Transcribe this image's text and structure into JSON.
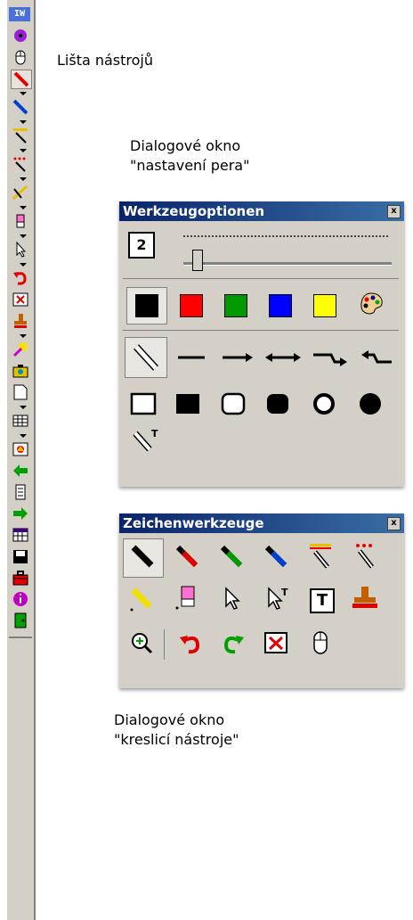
{
  "toolbar": {
    "logo": "IW",
    "label": "Lišta nástrojů",
    "icons": [
      "target-icon",
      "mouse-icon",
      "red-pen-icon",
      "blue-pen-icon",
      "highlighter-icon",
      "dots-pen-icon",
      "line-tool-icon",
      "eraser-icon",
      "pointer-icon",
      "undo-icon",
      "clear-icon",
      "stamp-icon",
      "torch-icon",
      "camera-icon",
      "page-icon",
      "grid-icon",
      "screen-icon",
      "back-arrow-icon",
      "page-list-icon",
      "forward-arrow-icon",
      "calendar-icon",
      "save-icon",
      "toolbox-icon",
      "info-icon",
      "exit-icon"
    ]
  },
  "pen_dialog": {
    "caption_line1": "Dialogové okno",
    "caption_line2": "\"nastavení pera\"",
    "title": "Werkzeugoptionen",
    "close": "x",
    "thickness": "2",
    "colors": [
      "#000000",
      "#ff0000",
      "#009900",
      "#0000ff",
      "#ffff00"
    ],
    "palette_icon": "palette-icon"
  },
  "draw_dialog": {
    "caption_line1": "Dialogové okno",
    "caption_line2": "\"kreslicí nástroje\"",
    "title": "Zeichenwerkzeuge",
    "close": "x",
    "text_tool": "T"
  }
}
